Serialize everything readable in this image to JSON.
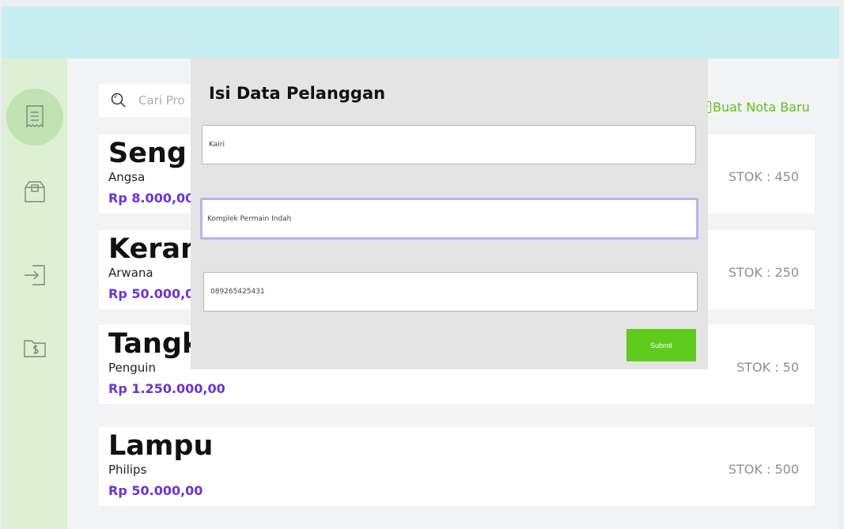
{
  "search": {
    "placeholder": "Cari Pro"
  },
  "new_note_label": "Buat Nota Baru",
  "sidebar": {
    "items": [
      {
        "icon": "receipt-icon",
        "active": true
      },
      {
        "icon": "box-icon",
        "active": false
      },
      {
        "icon": "login-icon",
        "active": false
      },
      {
        "icon": "money-folder-icon",
        "active": false
      }
    ]
  },
  "products": [
    {
      "name": "Seng",
      "brand": "Angsa",
      "price": "Rp 8.000,00",
      "stock": "STOK : 450"
    },
    {
      "name": "Keram",
      "brand": "Arwana",
      "price": "Rp 50.000,0",
      "stock": "STOK : 250"
    },
    {
      "name": "Tangki",
      "brand": "Penguin",
      "price": "Rp 1.250.000,00",
      "stock": "STOK : 50"
    },
    {
      "name": "Lampu",
      "brand": "Philips",
      "price": "Rp 50.000,00",
      "stock": "STOK : 500"
    }
  ],
  "modal": {
    "title": "Isi Data Pelanggan",
    "name_value": "Kairi",
    "address_value": "Komplek Permain Indah",
    "phone_value": "089265425431",
    "submit_label": "Submit"
  },
  "colors": {
    "topbar": "#c7eeee",
    "sidebar": "#ddf0d4",
    "accent_green": "#5fcb1c",
    "price_purple": "#6a34d6"
  }
}
